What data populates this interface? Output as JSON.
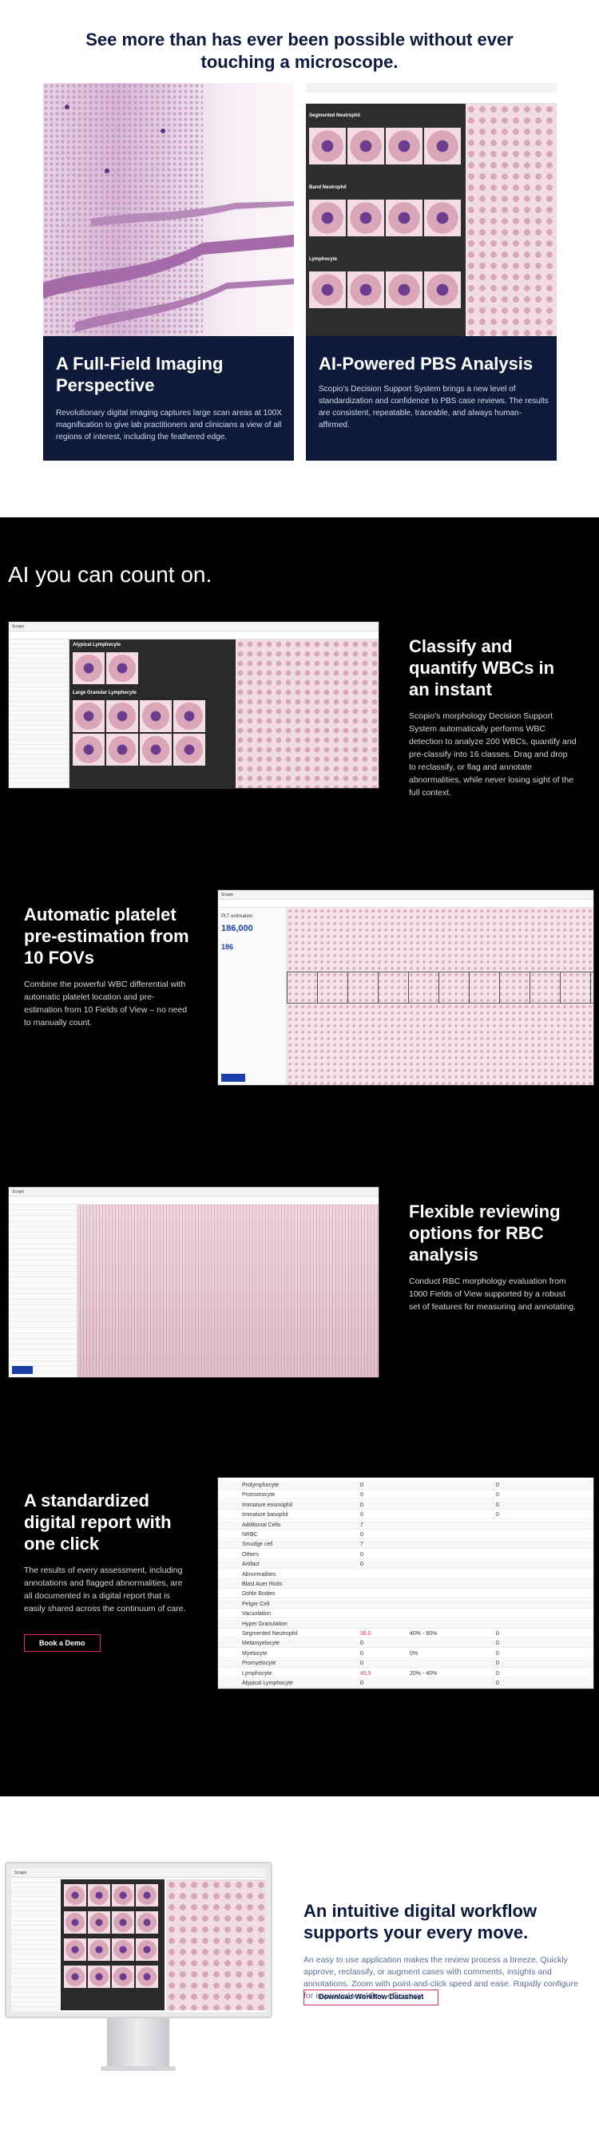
{
  "hero": {
    "title": "See more than has ever been possible without ever touching a microscope."
  },
  "cards": [
    {
      "title": "A Full-Field Imaging Perspective",
      "text": "Revolutionary digital imaging captures large scan areas at 100X magnification to give lab practitioners and clinicians a view of all regions of interest, including the feathered edge."
    },
    {
      "title": "AI-Powered PBS Analysis",
      "text": "Scopio's Decision Support System brings a new level of standardization and confidence to PBS case reviews. The results are consistent, repeatable, traceable, and always human-affirmed."
    }
  ],
  "pbs_ui": {
    "rows": [
      "Segmented Neutrophil",
      "Band Neutrophil",
      "Lymphocyte"
    ]
  },
  "ai": {
    "title": "AI you can count on."
  },
  "features": [
    {
      "title": "Classify and quantify WBCs in an instant",
      "text": "Scopio's morphology Decision Support System automatically performs WBC detection to analyze 200 WBCs, quantify and pre-classify into 16 classes. Drag and drop to reclassify, or flag and annotate abnormalities, while never losing sight of the full context."
    },
    {
      "title": "Automatic platelet pre-estimation from 10 FOVs",
      "text": "Combine the powerful WBC differential with automatic platelet location and pre-estimation from 10 Fields of View – no need to manually count."
    },
    {
      "title": "Flexible reviewing options for RBC analysis",
      "text": "Conduct RBC morphology evaluation from 1000 Fields of View supported by a robust set of features for measuring and annotating."
    },
    {
      "title": "A standardized digital report with one click",
      "text": "The results of every assessment, including annotations and flagged abnormalities, are all documented in a digital report that is easily shared across the continuum of care.",
      "button": "Book a Demo"
    }
  ],
  "wbc_ui": {
    "panel1": "Atypical Lymphocyte",
    "panel2": "Large Granular Lymphocyte"
  },
  "plt_ui": {
    "label": "PLT estimation",
    "value": "186,000",
    "value2": "186"
  },
  "report": {
    "rows": [
      {
        "name": "Prolymphocyte",
        "a": "0",
        "b": "",
        "c": "0"
      },
      {
        "name": "Promonocyte",
        "a": "0",
        "b": "",
        "c": "0"
      },
      {
        "name": "Immature eosinophil",
        "a": "0",
        "b": "",
        "c": "0"
      },
      {
        "name": "Immature basophil",
        "a": "0",
        "b": "",
        "c": "0"
      },
      {
        "name": "Additional Cells",
        "a": "7",
        "b": "",
        "c": ""
      },
      {
        "name": "NRBC",
        "a": "0",
        "b": "",
        "c": ""
      },
      {
        "name": "Smudge cell",
        "a": "7",
        "b": "",
        "c": ""
      },
      {
        "name": "Others",
        "a": "0",
        "b": "",
        "c": ""
      },
      {
        "name": "Artifact",
        "a": "0",
        "b": "",
        "c": ""
      },
      {
        "name": "Abnormalities",
        "a": "",
        "b": "",
        "c": ""
      },
      {
        "name": "Blast Auer Rods",
        "a": "",
        "b": "",
        "c": ""
      },
      {
        "name": "Dohle Bodies",
        "a": "",
        "b": "",
        "c": ""
      },
      {
        "name": "Pelger Cell",
        "a": "",
        "b": "",
        "c": ""
      },
      {
        "name": "Vacuolation",
        "a": "",
        "b": "",
        "c": ""
      },
      {
        "name": "Hyper Granulation",
        "a": "",
        "b": "",
        "c": ""
      },
      {
        "name": "Segmented Neutrophil",
        "a": "38.0",
        "b": "40% - 60%",
        "c": "0"
      },
      {
        "name": "Metamyelocyte",
        "a": "0",
        "b": "",
        "c": "0"
      },
      {
        "name": "Myelocyte",
        "a": "0",
        "b": "0%",
        "c": "0"
      },
      {
        "name": "Promyelocyte",
        "a": "0",
        "b": "",
        "c": "0"
      },
      {
        "name": "Lymphocyte",
        "a": "45.5",
        "b": "20% - 40%",
        "c": "0"
      },
      {
        "name": "Atypical Lymphocyte",
        "a": "0",
        "b": "",
        "c": "0"
      }
    ]
  },
  "workflow": {
    "title": "An intuitive digital workflow supports your every move.",
    "text": "An easy to use application makes the review process a breeze. Quickly approve, reclassify, or augment cases with comments, insights and annotations. Zoom with point-and-click speed and ease. Rapidly configure for improved workflow efficiency.",
    "button": "Download Workflow Datasheet"
  },
  "app": {
    "brand": "Scopio"
  },
  "colors": {
    "navy": "#0e1a3a",
    "accent": "#d2335b",
    "black": "#000000"
  }
}
